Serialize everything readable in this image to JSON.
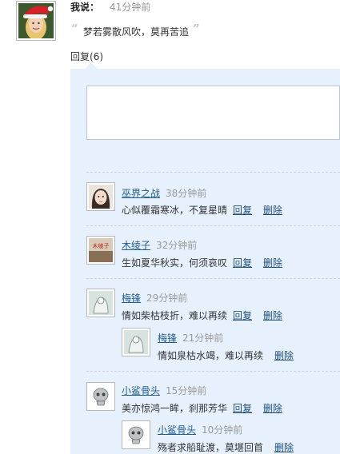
{
  "post": {
    "author_label": "我说：",
    "time": "41分钟前",
    "content": "梦若雾散风吹，莫再苦追",
    "quote_open": "“",
    "quote_close": "”",
    "reply_label": "回复",
    "reply_count": "(6)"
  },
  "reply_box": {
    "value": "",
    "placeholder": ""
  },
  "comments": [
    {
      "name": "巫界之战",
      "time": "38分钟前",
      "text": "心似覆霜寒冰，不复星晴",
      "reply": "回复",
      "delete": "删除"
    },
    {
      "name": "木绫子",
      "time": "32分钟前",
      "text": "生如夏华秋实，何须哀叹",
      "reply": "回复",
      "delete": "删除",
      "avatar_text": "木绫子"
    },
    {
      "name": "梅锋",
      "time": "29分钟前",
      "text": "情如柴枯枝折，难以再续",
      "reply": "回复",
      "delete": "删除"
    },
    {
      "name": "梅锋",
      "time": "21分钟前",
      "text": "情如泉枯水竭，难以再续",
      "delete": "删除"
    },
    {
      "name": "小鲨骨头",
      "time": "15分钟前",
      "text": "美亦惊鸿一眸，刹那芳华",
      "reply": "回复",
      "delete": "删除"
    },
    {
      "name": "小鲨骨头",
      "time": "10分钟前",
      "text": "殇者求船耻渡，莫堪回首",
      "delete": "删除"
    }
  ],
  "colors": {
    "panel_bg": "#e6f1fd",
    "link": "#1f5c8b",
    "muted": "#999999"
  }
}
